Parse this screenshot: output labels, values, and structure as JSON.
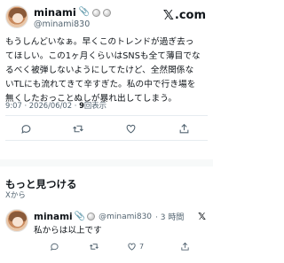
{
  "tweet": {
    "user": {
      "name": "minami",
      "handle": "@minami830",
      "emoji": "📎"
    },
    "logo": {
      "x": "𝕏",
      "suffix": ".com"
    },
    "text_lines": [
      "もうしんどいなぁ。早くこのトレンドが過ぎ去っ",
      "てほしい。この1ヶ月くらいはSNSも全て薄目でな",
      "るべく被弾しないようにしてたけど、全然関係な",
      "いTLにも流れてきて辛すぎた。私の中で行き場を",
      "無くしたおっことぬしが暴れ出してしまう。"
    ],
    "meta": {
      "timestamp": "9:07 · 2026/06/02 · ",
      "views_count": "9",
      "views_label": "回表示"
    }
  },
  "more": {
    "title": "もっと見つける",
    "subtitle": "Xから"
  },
  "reply": {
    "name": "minami",
    "emoji": "📎",
    "handle": "@minami830",
    "time": "· 3 時間",
    "logo": "𝕏",
    "text": "私からは以上です",
    "like_count": "7"
  },
  "colors": {
    "text": "#0f1419",
    "secondary": "#536471",
    "divider": "#e6ecf0",
    "background": "#ffffff"
  }
}
